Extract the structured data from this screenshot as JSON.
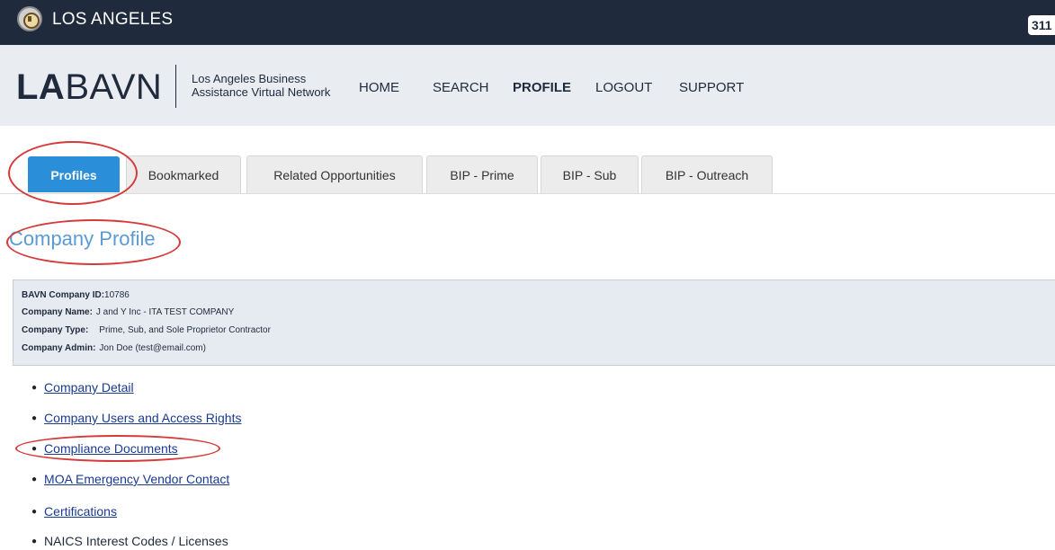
{
  "citybar": {
    "title": "LOS ANGELES",
    "badge": "311"
  },
  "header": {
    "logo_la": "LA",
    "logo_bavn": "BAVN",
    "subtitle_line1": "Los Angeles Business",
    "subtitle_line2": "Assistance Virtual Network",
    "nav": [
      "HOME",
      "SEARCH",
      "PROFILE",
      "LOGOUT",
      "SUPPORT"
    ],
    "active_nav": "PROFILE"
  },
  "tabs": [
    "Profiles",
    "Bookmarked",
    "Related Opportunities",
    "BIP - Prime",
    "BIP - Sub",
    "BIP - Outreach"
  ],
  "active_tab": "Profiles",
  "page_title": "Company Profile",
  "company": {
    "id_label": "BAVN Company ID:",
    "id_value": "10786",
    "name_label": "Company Name:",
    "name_value": "J and Y Inc - ITA TEST COMPANY",
    "type_label": "Company Type:",
    "type_value": "Prime, Sub, and Sole Proprietor Contractor",
    "admin_label": "Company Admin:",
    "admin_value": "Jon Doe (test@email.com)"
  },
  "links": [
    "Company Detail",
    "Company Users and Access Rights",
    "Compliance Documents",
    "MOA Emergency Vendor Contact",
    "Certifications",
    "NAICS Interest Codes / Licenses"
  ],
  "colors": {
    "city_bar": "#1f2a3c",
    "header_bg": "#e9ecf0",
    "active_tab": "#2b8ed8",
    "highlight": "#d63a3a",
    "title": "#5b9bd5",
    "link": "#1a3a8f"
  }
}
